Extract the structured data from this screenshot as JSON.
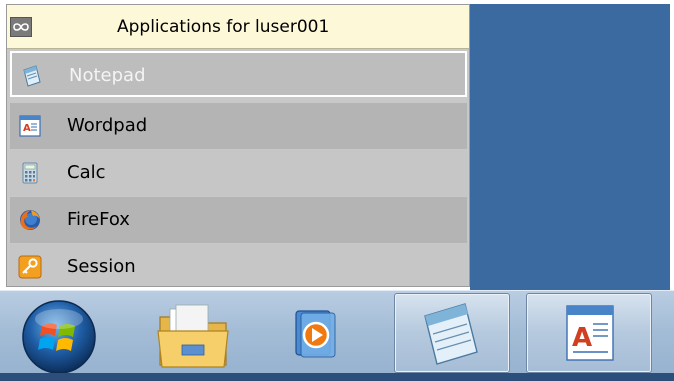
{
  "menu": {
    "title": "Applications for luser001",
    "items": [
      {
        "label": "Notepad",
        "icon": "notepad-icon",
        "selected": true
      },
      {
        "label": "Wordpad",
        "icon": "wordpad-icon"
      },
      {
        "label": "Calc",
        "icon": "calculator-icon"
      },
      {
        "label": "FireFox",
        "icon": "firefox-icon"
      },
      {
        "label": "Session",
        "icon": "key-icon"
      }
    ]
  },
  "taskbar": {
    "start_icon": "windows-logo-icon",
    "pinned": [
      {
        "icon": "folder-icon"
      },
      {
        "icon": "media-player-icon"
      }
    ],
    "running": [
      {
        "icon": "notepad-icon",
        "active": true
      },
      {
        "icon": "wordpad-icon"
      }
    ]
  },
  "colors": {
    "desktop": "#3a6aa0",
    "menu_header": "#fcf8d8",
    "taskbar": "#a3bcd6"
  }
}
